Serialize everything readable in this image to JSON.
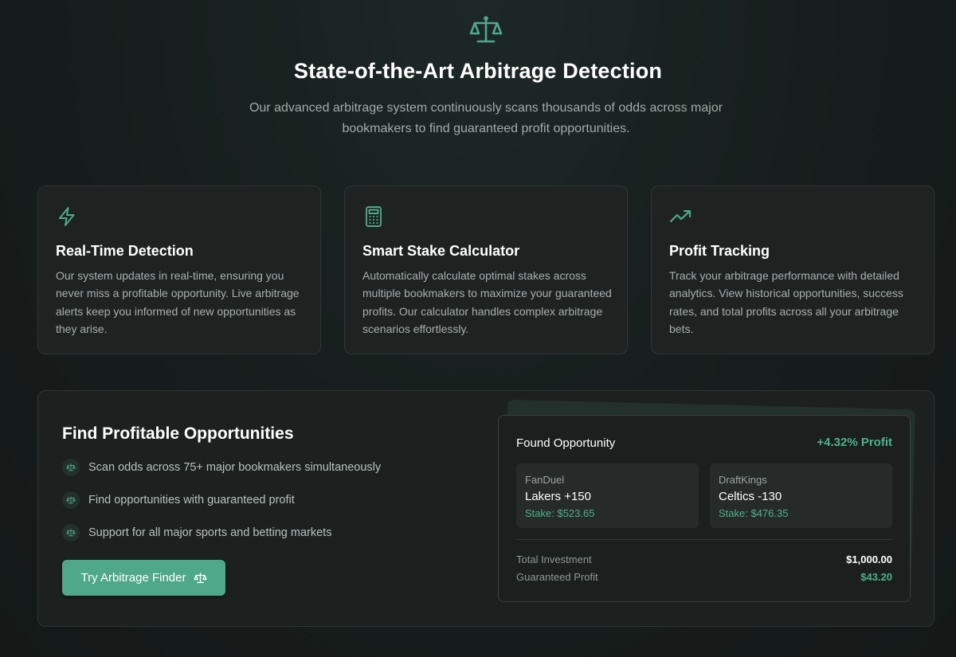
{
  "colors": {
    "accent": "#4fa889",
    "profit": "#4fb08c",
    "card": "#1e2322",
    "background": "#161c1b"
  },
  "hero": {
    "icon": "scale-icon",
    "title": "State-of-the-Art Arbitrage Detection",
    "subtitle": "Our advanced arbitrage system continuously scans thousands of odds across major bookmakers to find guaranteed profit opportunities."
  },
  "features": [
    {
      "icon": "lightning-icon",
      "title": "Real-Time Detection",
      "text": "Our system updates in real-time, ensuring you never miss a profitable opportunity. Live arbitrage alerts keep you informed of new opportunities as they arise."
    },
    {
      "icon": "calculator-icon",
      "title": "Smart Stake Calculator",
      "text": "Automatically calculate optimal stakes across multiple bookmakers to maximize your guaranteed profits. Our calculator handles complex arbitrage scenarios effortlessly."
    },
    {
      "icon": "trending-up-icon",
      "title": "Profit Tracking",
      "text": "Track your arbitrage performance with detailed analytics. View historical opportunities, success rates, and total profits across all your arbitrage bets."
    }
  ],
  "finder": {
    "title": "Find Profitable Opportunities",
    "points": [
      "Scan odds across 75+ major bookmakers simultaneously",
      "Find opportunities with guaranteed profit",
      "Support for all major sports and betting markets"
    ],
    "button_label": "Try Arbitrage Finder"
  },
  "opportunity": {
    "heading": "Found Opportunity",
    "profit": "+4.32% Profit",
    "books": [
      {
        "name": "FanDuel",
        "odds": "Lakers +150",
        "stake": "Stake: $523.65"
      },
      {
        "name": "DraftKings",
        "odds": "Celtics -130",
        "stake": "Stake: $476.35"
      }
    ],
    "total_label": "Total Investment",
    "total_value": "$1,000.00",
    "guaranteed_label": "Guaranteed Profit",
    "guaranteed_value": "$43.20"
  }
}
